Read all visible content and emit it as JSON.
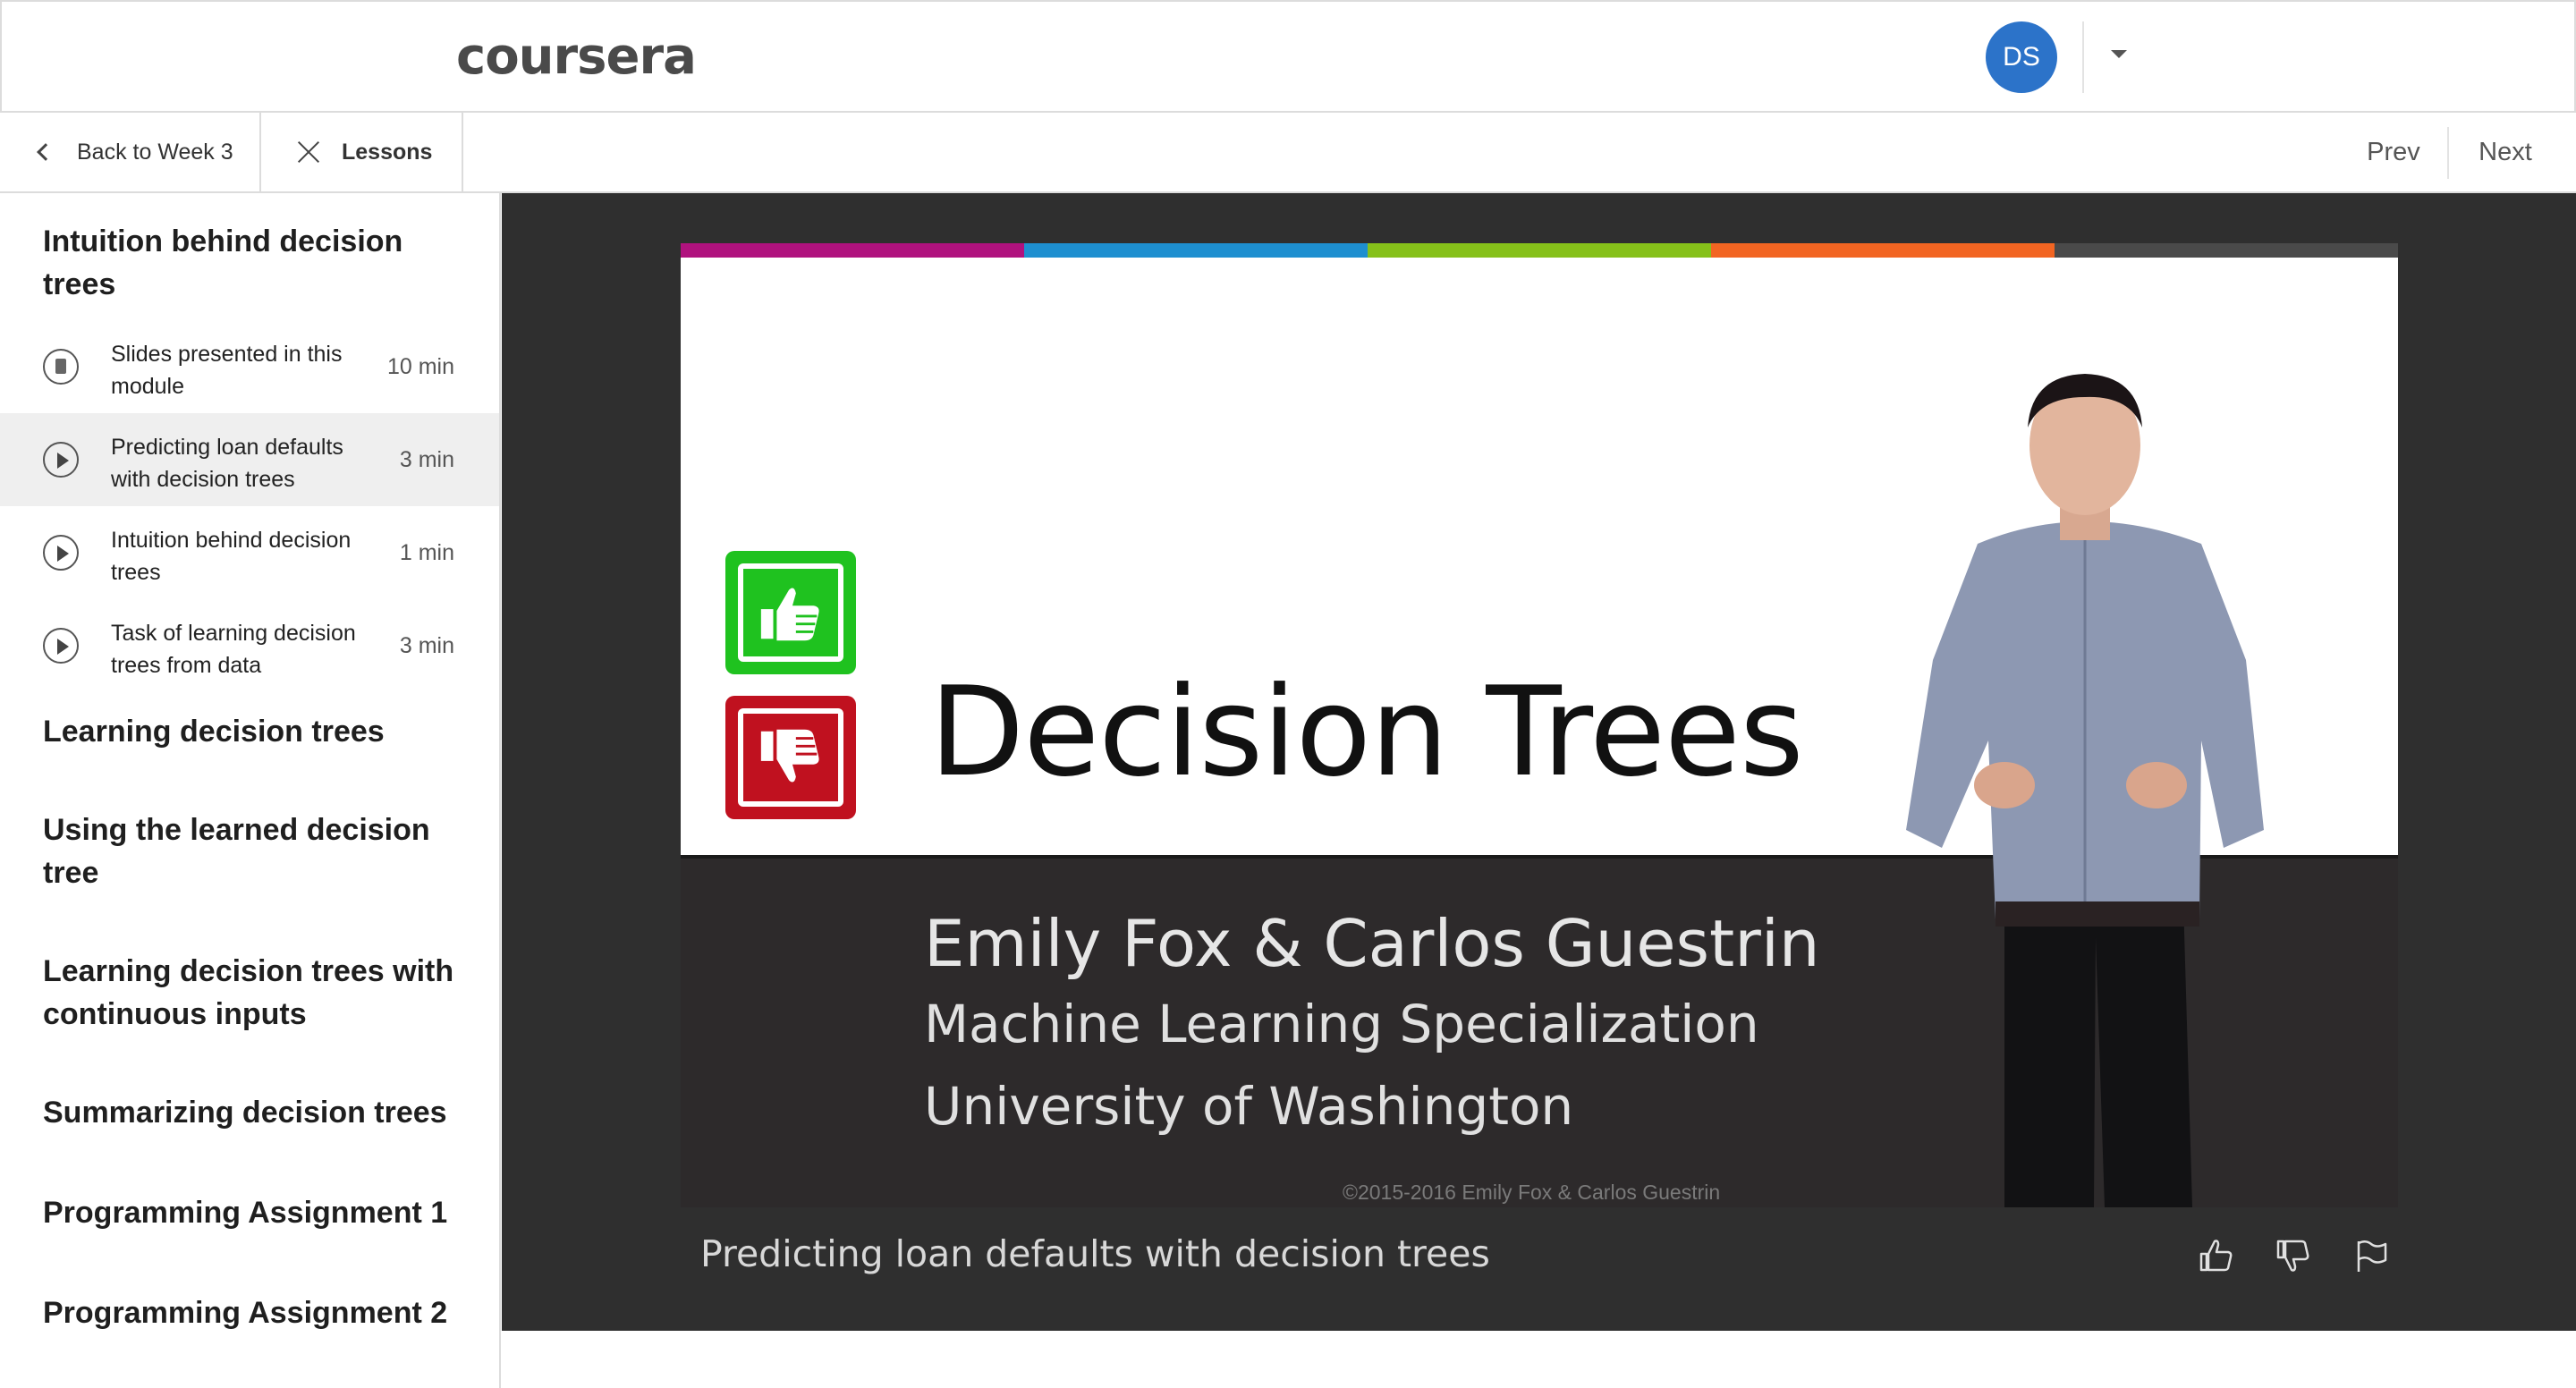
{
  "header": {
    "logo_text": "coursera",
    "avatar_initials": "DS"
  },
  "nav": {
    "back_label": "Back to Week 3",
    "lessons_label": "Lessons",
    "prev_label": "Prev",
    "next_label": "Next"
  },
  "sidebar": {
    "current_module": {
      "title": "Intuition behind decision trees",
      "items": [
        {
          "label": "Slides presented in this module",
          "duration": "10 min",
          "icon": "reading-icon",
          "active": false
        },
        {
          "label": "Predicting loan defaults with decision trees",
          "duration": "3 min",
          "icon": "play-icon",
          "active": true
        },
        {
          "label": "Intuition behind decision trees",
          "duration": "1 min",
          "icon": "play-icon",
          "active": false
        },
        {
          "label": "Task of learning decision trees from data",
          "duration": "3 min",
          "icon": "play-icon",
          "active": false
        }
      ]
    },
    "modules": [
      "Learning decision trees",
      "Using the learned decision tree",
      "Learning decision trees with continuous inputs",
      "Summarizing decision trees",
      "Programming Assignment 1",
      "Programming Assignment 2"
    ]
  },
  "video": {
    "slide_title": "Decision Trees",
    "authors": "Emily Fox & Carlos Guestrin",
    "specialization": "Machine Learning Specialization",
    "university": "University of Washington",
    "copyright": "©2015-2016 Emily Fox & Carlos Guestrin",
    "caption": "Predicting loan defaults with decision trees",
    "stripe_colors": [
      "#b0127e",
      "#1e8fd0",
      "#86c11a",
      "#f26522",
      "#4a4a4a"
    ],
    "thumbs_up_color": "#1fc21f",
    "thumbs_down_color": "#c0111f"
  },
  "colors": {
    "avatar": "#2c73c9",
    "video_background": "#2f2f2f"
  }
}
